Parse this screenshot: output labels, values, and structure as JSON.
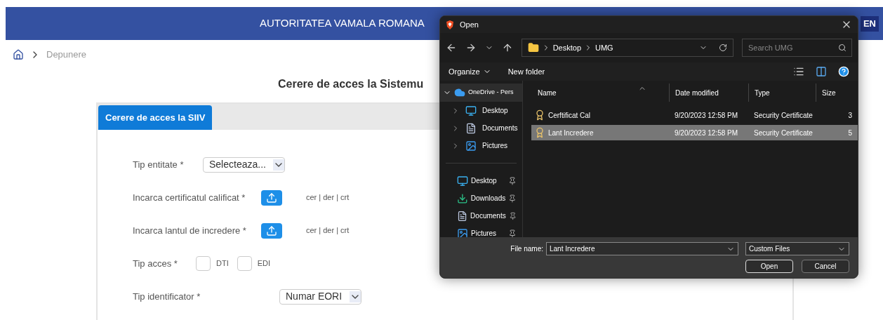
{
  "header": {
    "title": "AUTORITATEA VAMALA ROMANA",
    "language": "EN"
  },
  "breadcrumb": [
    "Depunere"
  ],
  "page_title": "Cerere de acces la Sistemu",
  "tabs": [
    {
      "label": "Cerere de acces la SIIV",
      "selected": true
    }
  ],
  "form": [
    {
      "kind": "select",
      "label": "Tip entitate *",
      "value": "Selecteaza..."
    },
    {
      "kind": "upload",
      "label": "Incarca certificatul calificat *",
      "hint": "cer | der | crt"
    },
    {
      "kind": "upload",
      "label": "Incarca lantul de incredere *",
      "hint": "cer | der | crt"
    },
    {
      "kind": "checks",
      "label": "Tip acces *",
      "options": [
        {
          "label": "DTI",
          "checked": false
        },
        {
          "label": "EDI",
          "checked": false
        }
      ]
    },
    {
      "kind": "select",
      "label": "Tip identificator *",
      "value": "Numar EORI"
    }
  ],
  "dialog": {
    "title": "Open",
    "path": [
      "Desktop",
      "UMG"
    ],
    "search_placeholder": "Search UMG",
    "toolbar": [
      "Organize",
      "New folder"
    ],
    "tree": [
      {
        "label": "OneDrive - Pers",
        "expanded": true,
        "selected": true,
        "children": [
          {
            "label": "Desktop",
            "expanded": false,
            "selected": false
          },
          {
            "label": "Documents",
            "expanded": false,
            "selected": false
          },
          {
            "label": "Pictures",
            "expanded": false,
            "selected": false
          }
        ]
      }
    ],
    "quick_access": [
      {
        "label": "Desktop"
      },
      {
        "label": "Downloads"
      },
      {
        "label": "Documents"
      },
      {
        "label": "Pictures"
      }
    ],
    "columns": [
      "Name",
      "Date modified",
      "Type",
      "Size"
    ],
    "files": [
      {
        "name": "Cerftificat Cal",
        "date": "9/20/2023 12:58 PM",
        "type": "Security Certificate",
        "size": "3",
        "selected": false
      },
      {
        "name": "Lant Incredere",
        "date": "9/20/2023 12:58 PM",
        "type": "Security Certificate",
        "size": "5",
        "selected": true
      }
    ],
    "file_name_label": "File name:",
    "file_name": "Lant Incredere",
    "file_type": "Custom Files",
    "buttons": [
      "Open",
      "Cancel"
    ]
  }
}
